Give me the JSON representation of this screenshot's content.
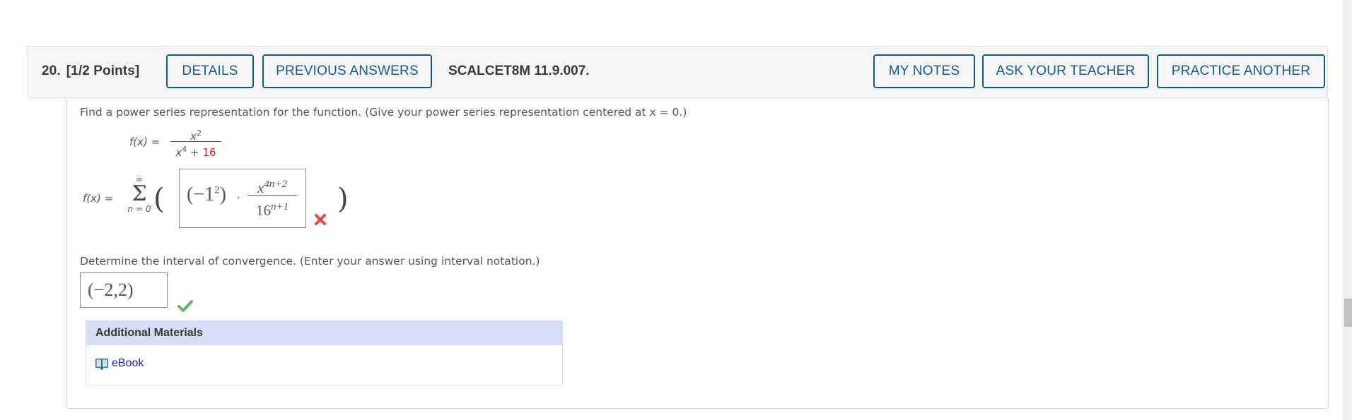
{
  "header": {
    "question_number": "20.",
    "points": "[1/2 Points]",
    "buttons": {
      "details": "DETAILS",
      "previous_answers": "PREVIOUS ANSWERS",
      "my_notes": "MY NOTES",
      "ask_teacher": "ASK YOUR TEACHER",
      "practice_another": "PRACTICE ANOTHER"
    },
    "code": "SCALCET8M 11.9.007."
  },
  "question": {
    "prompt1": "Find a power series representation for the function. (Give your power series representation centered at x = 0.)",
    "function": {
      "lhs": "f(x) =",
      "numerator_base": "x",
      "numerator_exp": "2",
      "denominator_base": "x",
      "denominator_exp": "4",
      "denominator_plus": " + ",
      "denominator_const": "16"
    },
    "series": {
      "lhs": "f(x) =",
      "upper": "∞",
      "sigma": "Σ",
      "lower": "n = 0",
      "open_paren": "(",
      "close_paren": ")",
      "answer": {
        "coef_text": "(−1",
        "coef_exp": "2",
        "coef_close": ")",
        "dot": "·",
        "num_base": "x",
        "num_exp": "4n+2",
        "den_base": "16",
        "den_exp": "n+1"
      },
      "status": "incorrect"
    },
    "prompt2": "Determine the interval of convergence. (Enter your answer using interval notation.)",
    "interval_answer": "(−2,2)",
    "interval_status": "correct"
  },
  "materials": {
    "title": "Additional Materials",
    "links": [
      {
        "label": "eBook",
        "icon": "book-icon"
      }
    ]
  },
  "colors": {
    "accent": "#0f5c8e",
    "incorrect": "#e8474f",
    "correct": "#5cb85c",
    "link": "#1a1ac8",
    "materials_header": "#d6ddf5"
  }
}
